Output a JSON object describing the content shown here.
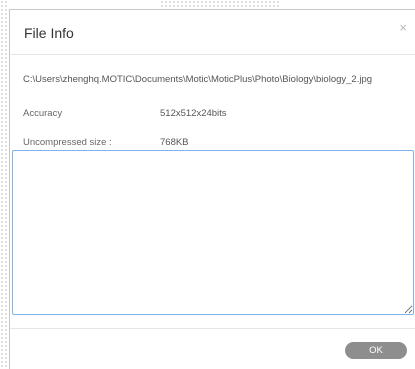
{
  "dialog": {
    "title": "File Info",
    "close_glyph": "×",
    "close_icon": "close-icon"
  },
  "file": {
    "path": "C:\\Users\\zhenghq.MOTIC\\Documents\\Motic\\MoticPlus\\Photo\\Biology\\biology_2.jpg",
    "accuracy_label": "Accuracy",
    "accuracy_value": "512x512x24bits",
    "size_label": "Uncompressed size :",
    "size_value": "768KB"
  },
  "notes": {
    "value": ""
  },
  "footer": {
    "ok_label": "OK"
  },
  "colors": {
    "notes_border": "#7eb4ea",
    "ok_button_bg": "#8e8e8e",
    "text": "#555555"
  }
}
